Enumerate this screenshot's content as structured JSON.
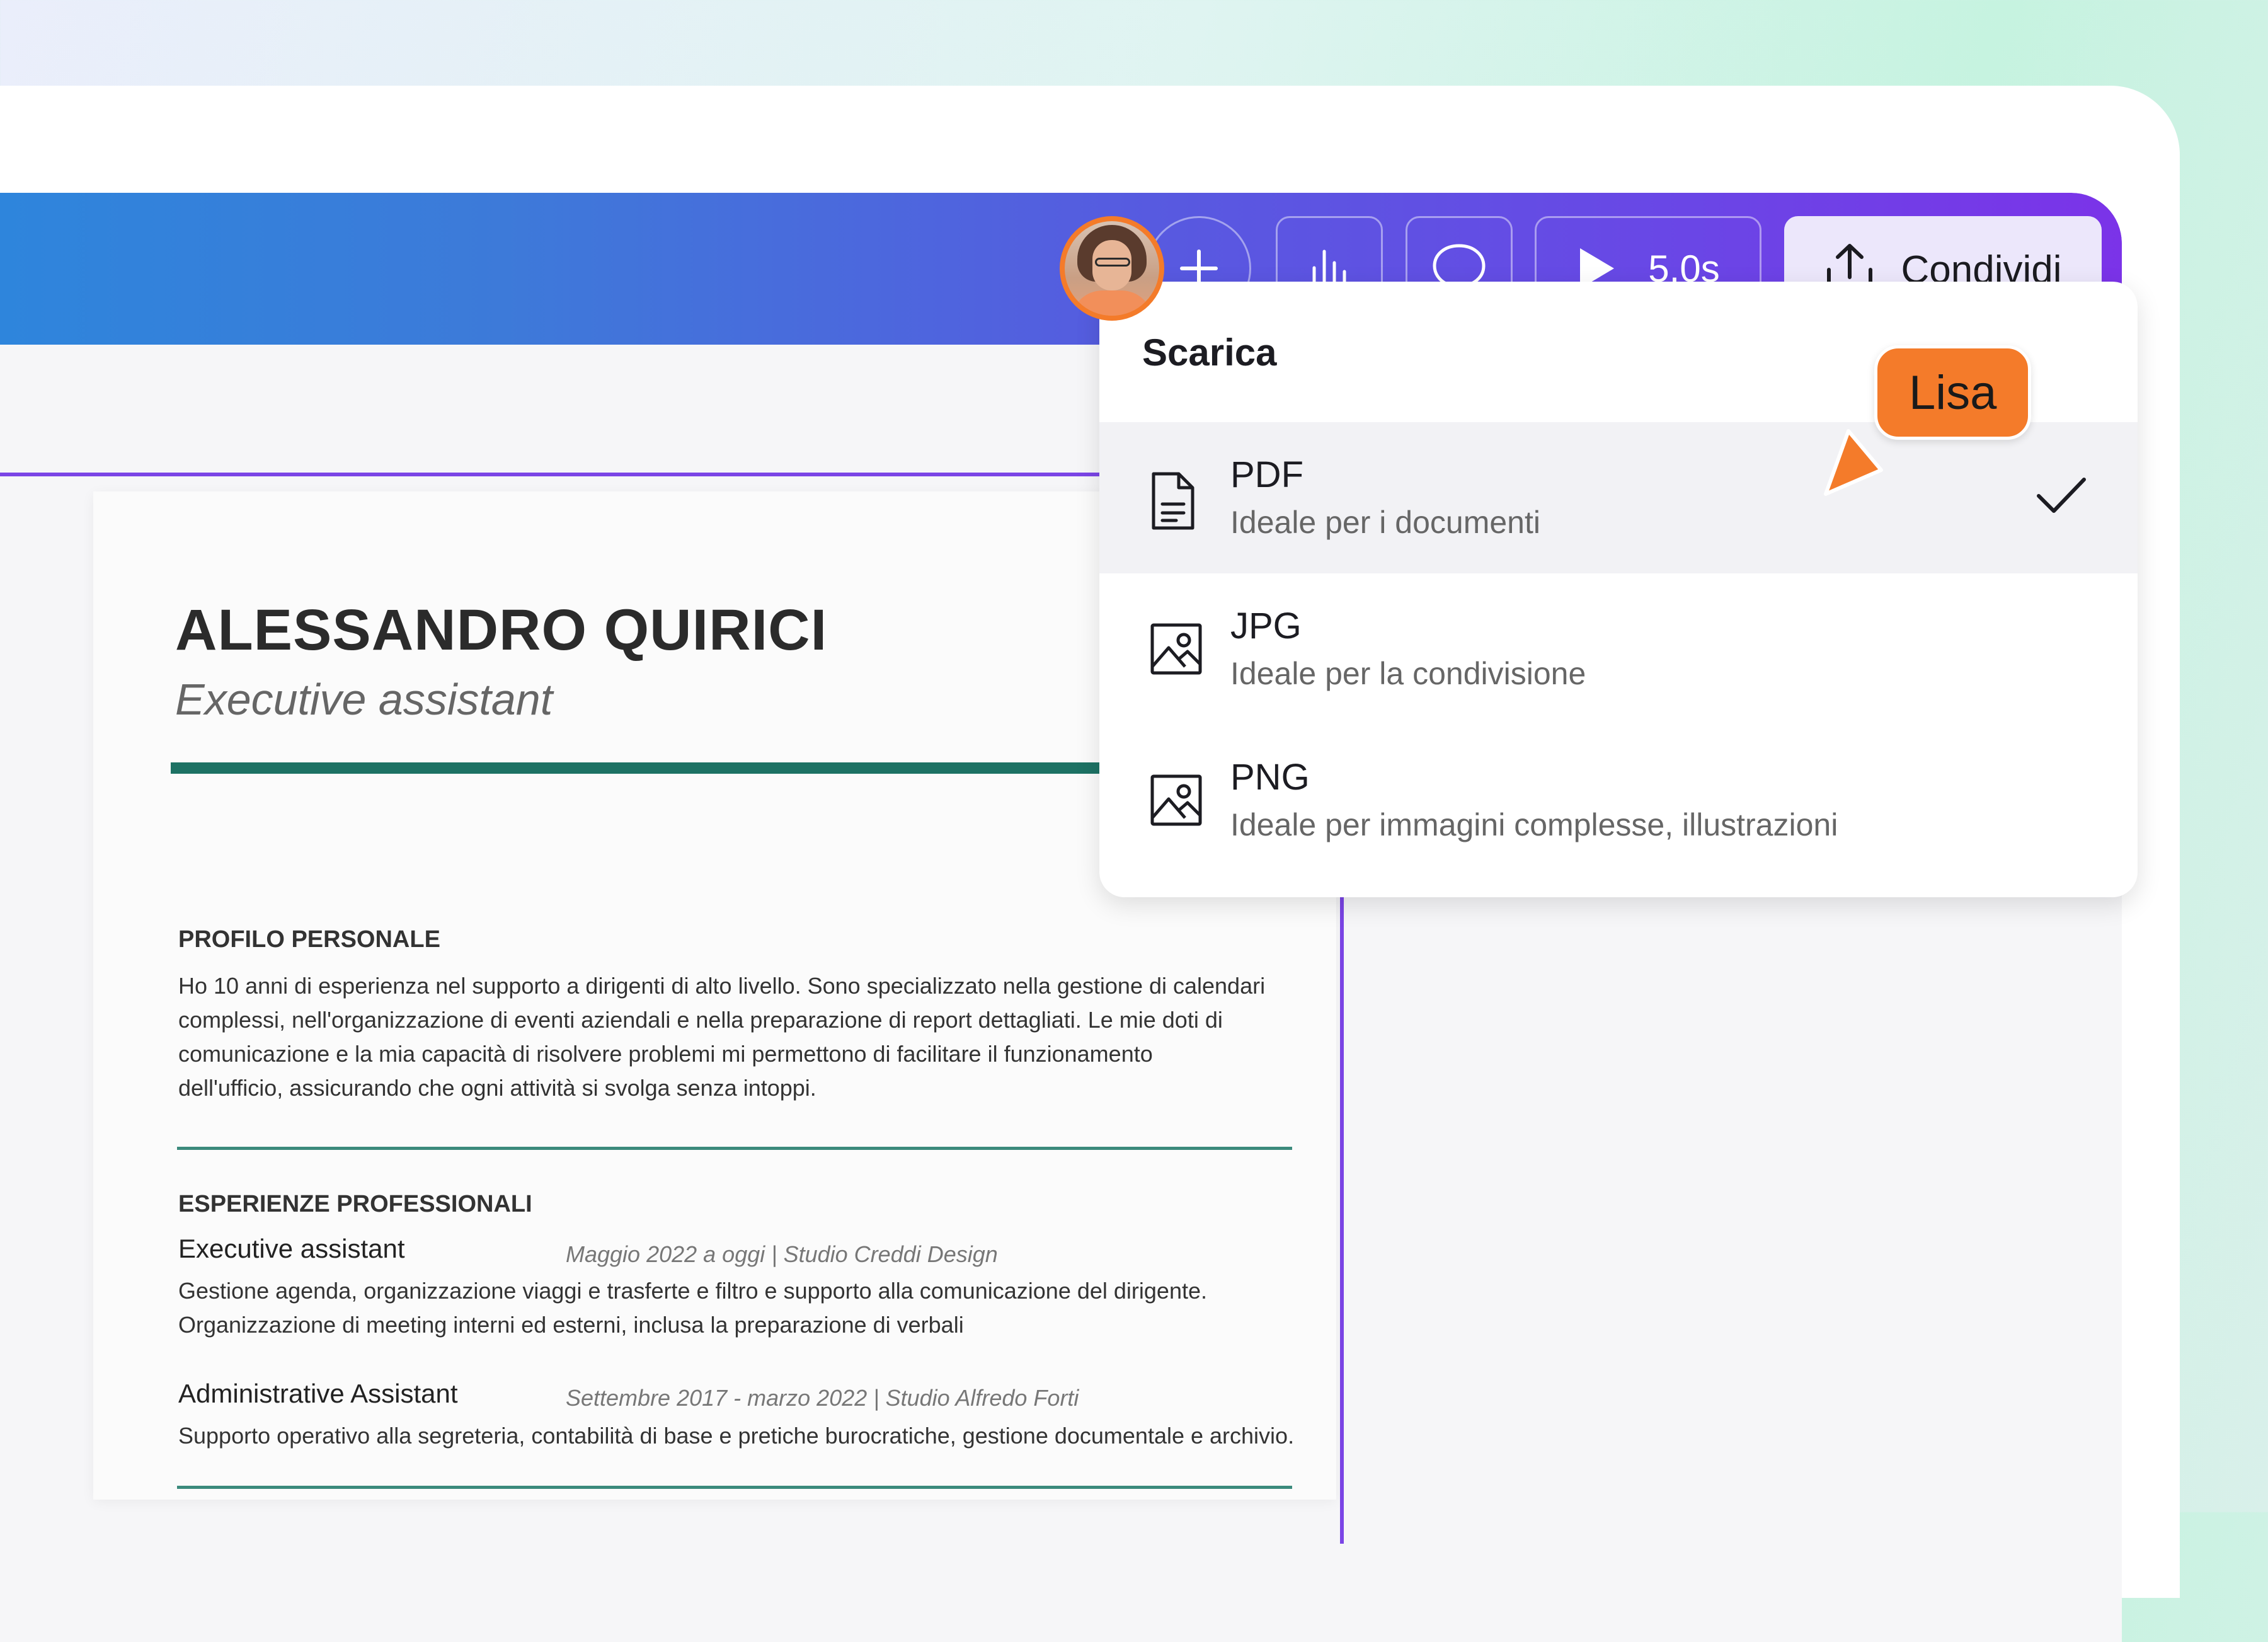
{
  "toolbar": {
    "avatar_alt": "collaborator avatar",
    "add_icon": "plus-icon",
    "stats_icon": "bar-chart-icon",
    "comment_icon": "speech-bubble-icon",
    "play_icon": "play-icon",
    "play_duration": "5.0s",
    "share_icon": "upload-icon",
    "share_label": "Condividi"
  },
  "download_menu": {
    "title": "Scarica",
    "items": [
      {
        "name": "PDF",
        "description": "Ideale per i documenti",
        "icon": "document-icon",
        "selected": true
      },
      {
        "name": "JPG",
        "description": "Ideale per la condivisione",
        "icon": "image-icon",
        "selected": false
      },
      {
        "name": "PNG",
        "description": "Ideale per immagini complesse, illustrazioni",
        "icon": "image-icon",
        "selected": false
      }
    ]
  },
  "collaborator": {
    "name": "Lisa",
    "color": "#f47b2a"
  },
  "resume": {
    "name": "ALESSANDRO QUIRICI",
    "role": "Executive assistant",
    "profile_title": "PROFILO PERSONALE",
    "profile_lines": [
      "Ho 10 anni di esperienza nel supporto a dirigenti di alto livello. Sono specializzato nella gestione di calendari",
      "complessi, nell'organizzazione di eventi aziendali e nella preparazione di report dettagliati. Le mie doti di",
      "comunicazione e la mia capacità di risolvere problemi mi permettono di facilitare il funzionamento",
      "dell'ufficio, assicurando che ogni attività si svolga senza intoppi."
    ],
    "experience_title": "ESPERIENZE PROFESSIONALI",
    "jobs": [
      {
        "title": "Executive assistant",
        "meta": "Maggio 2022 a oggi | Studio Creddi Design",
        "lines": [
          "Gestione agenda, organizzazione viaggi e trasferte e filtro e supporto alla comunicazione del dirigente.",
          "Organizzazione di meeting interni ed esterni, inclusa la preparazione di verbali"
        ]
      },
      {
        "title": "Administrative Assistant",
        "meta": "Settembre 2017 - marzo 2022 | Studio Alfredo Forti",
        "lines": [
          "Supporto operativo alla segreteria, contabilità di base e pretiche burocratiche, gestione documentale e archivio."
        ]
      }
    ]
  },
  "colors": {
    "accent_purple": "#7b45e6",
    "resume_accent": "#1d7264",
    "collaborator": "#f47b2a"
  }
}
